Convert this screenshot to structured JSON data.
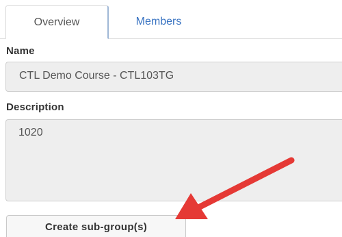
{
  "tabs": {
    "overview_label": "Overview",
    "members_label": "Members"
  },
  "form": {
    "name_label": "Name",
    "name_value": "CTL Demo Course - CTL103TG",
    "description_label": "Description",
    "description_value": "1020"
  },
  "actions": {
    "create_subgroups_label": "Create sub-group(s)"
  },
  "annotation": {
    "arrow_color": "#e53935",
    "arrow_icon": "red-arrow-icon"
  },
  "colors": {
    "link": "#3a74c2",
    "input_bg": "#eeeeee"
  }
}
